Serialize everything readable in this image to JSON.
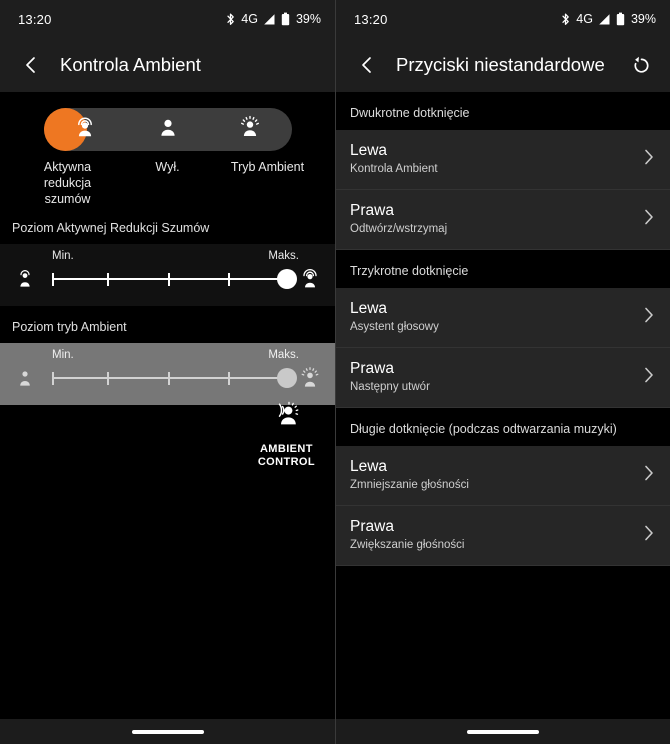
{
  "status_bar": {
    "time": "13:20",
    "bluetooth_icon": "bluetooth-icon",
    "network_label": "4G",
    "signal_icon": "signal-icon",
    "battery_icon": "battery-icon",
    "battery_label": "39%"
  },
  "left_screen": {
    "appbar": {
      "back_icon": "back-chevron-icon",
      "title": "Kontrola Ambient"
    },
    "modes": {
      "selected_index": 0,
      "accent_color": "#ee7722",
      "items": [
        {
          "label": "Aktywna redukcja szumów",
          "icon": "anc-person-icon"
        },
        {
          "label": "Wył.",
          "icon": "person-icon"
        },
        {
          "label": "Tryb Ambient",
          "icon": "ambient-person-icon"
        }
      ]
    },
    "anc_level": {
      "section_title": "Poziom Aktywnej Redukcji Szumów",
      "min_label": "Min.",
      "max_label": "Maks.",
      "left_icon": "anc-small-icon",
      "right_icon": "anc-strong-icon",
      "steps": 5,
      "value": 5,
      "enabled": true
    },
    "ambient_level": {
      "section_title": "Poziom tryb Ambient",
      "min_label": "Min.",
      "max_label": "Maks.",
      "left_icon": "person-small-icon",
      "right_icon": "ambient-strong-icon",
      "steps": 5,
      "value": 5,
      "enabled": false
    },
    "branding": {
      "icon": "ambient-control-logo-icon",
      "line1": "AMBIENT",
      "line2": "CONTROL"
    }
  },
  "right_screen": {
    "appbar": {
      "back_icon": "back-chevron-icon",
      "title": "Przyciski niestandardowe",
      "reset_icon": "restore-icon"
    },
    "groups": [
      {
        "title": "Dwukrotne dotknięcie",
        "rows": [
          {
            "title": "Lewa",
            "value": "Kontrola Ambient",
            "chevron": "chevron-right-icon"
          },
          {
            "title": "Prawa",
            "value": "Odtwórz/wstrzymaj",
            "chevron": "chevron-right-icon"
          }
        ]
      },
      {
        "title": "Trzykrotne dotknięcie",
        "rows": [
          {
            "title": "Lewa",
            "value": "Asystent głosowy",
            "chevron": "chevron-right-icon"
          },
          {
            "title": "Prawa",
            "value": "Następny utwór",
            "chevron": "chevron-right-icon"
          }
        ]
      },
      {
        "title": "Długie dotknięcie (podczas odtwarzania muzyki)",
        "rows": [
          {
            "title": "Lewa",
            "value": "Zmniejszanie głośności",
            "chevron": "chevron-right-icon"
          },
          {
            "title": "Prawa",
            "value": "Zwiększanie głośności",
            "chevron": "chevron-right-icon"
          }
        ]
      }
    ]
  },
  "nav_bar": {
    "pill": "home-gesture-pill"
  }
}
